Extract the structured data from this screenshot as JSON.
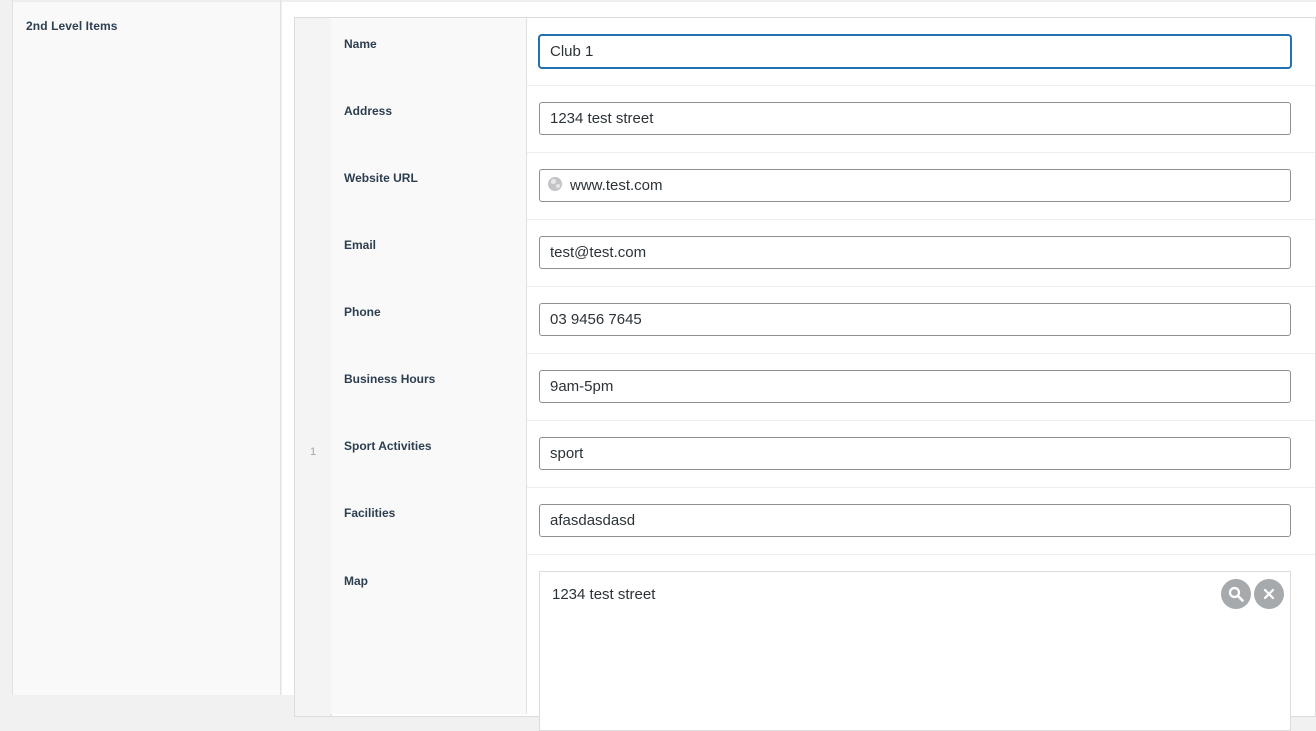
{
  "sidebar": {
    "section_label": "2nd Level Items"
  },
  "repeater": {
    "row_number": "1",
    "fields": {
      "name": {
        "label": "Name",
        "value": "Club 1"
      },
      "address": {
        "label": "Address",
        "value": "1234 test street"
      },
      "website": {
        "label": "Website URL",
        "value": "www.test.com",
        "icon": "globe-icon"
      },
      "email": {
        "label": "Email",
        "value": "test@test.com"
      },
      "phone": {
        "label": "Phone",
        "value": "03 9456 7645"
      },
      "hours": {
        "label": "Business Hours",
        "value": "9am-5pm"
      },
      "sport": {
        "label": "Sport Activities",
        "value": "sport"
      },
      "facilities": {
        "label": "Facilities",
        "value": "afasdasdasd"
      },
      "map": {
        "label": "Map",
        "search_value": "1234 test street",
        "search_icon": "search-icon",
        "clear_icon": "close-icon"
      }
    }
  }
}
